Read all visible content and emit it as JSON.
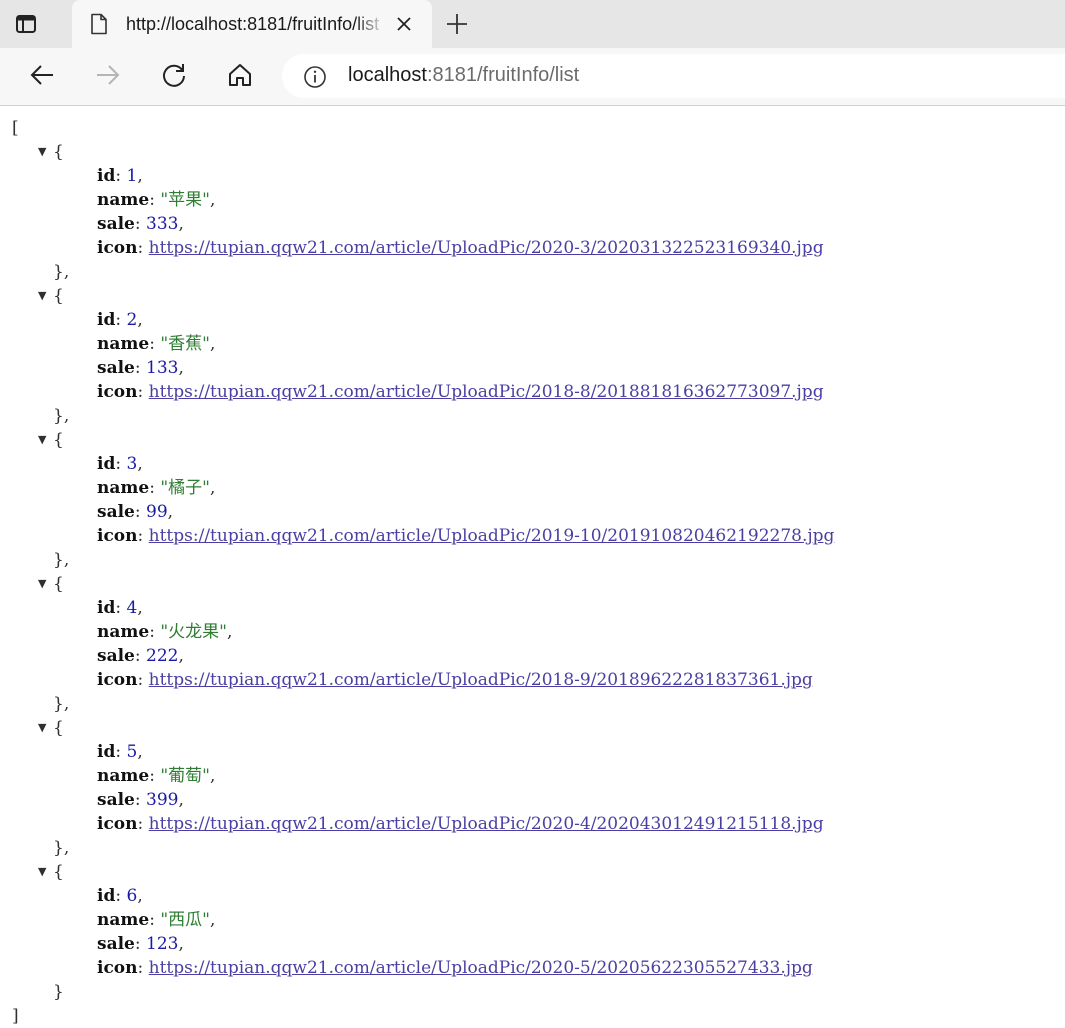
{
  "browser": {
    "tab_title": "http://localhost:8181/fruitInfo/list",
    "address": {
      "host": "localhost",
      "rest": ":8181/fruitInfo/list"
    }
  },
  "json": {
    "open_bracket": "[",
    "close_bracket": "]",
    "items": [
      {
        "id": "1",
        "name": "\"苹果\"",
        "sale": "333",
        "icon": "https://tupian.qqw21.com/article/UploadPic/2020-3/202031322523169340.jpg"
      },
      {
        "id": "2",
        "name": "\"香蕉\"",
        "sale": "133",
        "icon": "https://tupian.qqw21.com/article/UploadPic/2018-8/201881816362773097.jpg"
      },
      {
        "id": "3",
        "name": "\"橘子\"",
        "sale": "99",
        "icon": "https://tupian.qqw21.com/article/UploadPic/2019-10/201910820462192278.jpg"
      },
      {
        "id": "4",
        "name": "\"火龙果\"",
        "sale": "222",
        "icon": "https://tupian.qqw21.com/article/UploadPic/2018-9/20189622281837361.jpg"
      },
      {
        "id": "5",
        "name": "\"葡萄\"",
        "sale": "399",
        "icon": "https://tupian.qqw21.com/article/UploadPic/2020-4/202043012491215118.jpg"
      },
      {
        "id": "6",
        "name": "\"西瓜\"",
        "sale": "123",
        "icon": "https://tupian.qqw21.com/article/UploadPic/2020-5/20205622305527433.jpg"
      }
    ]
  },
  "icons": {
    "tab_actions": "tab-actions-icon",
    "page": "page-icon",
    "close": "close-icon",
    "new_tab": "plus-icon",
    "back": "back-arrow-icon",
    "forward": "forward-arrow-icon",
    "refresh": "refresh-icon",
    "home": "home-icon",
    "info": "info-icon"
  }
}
